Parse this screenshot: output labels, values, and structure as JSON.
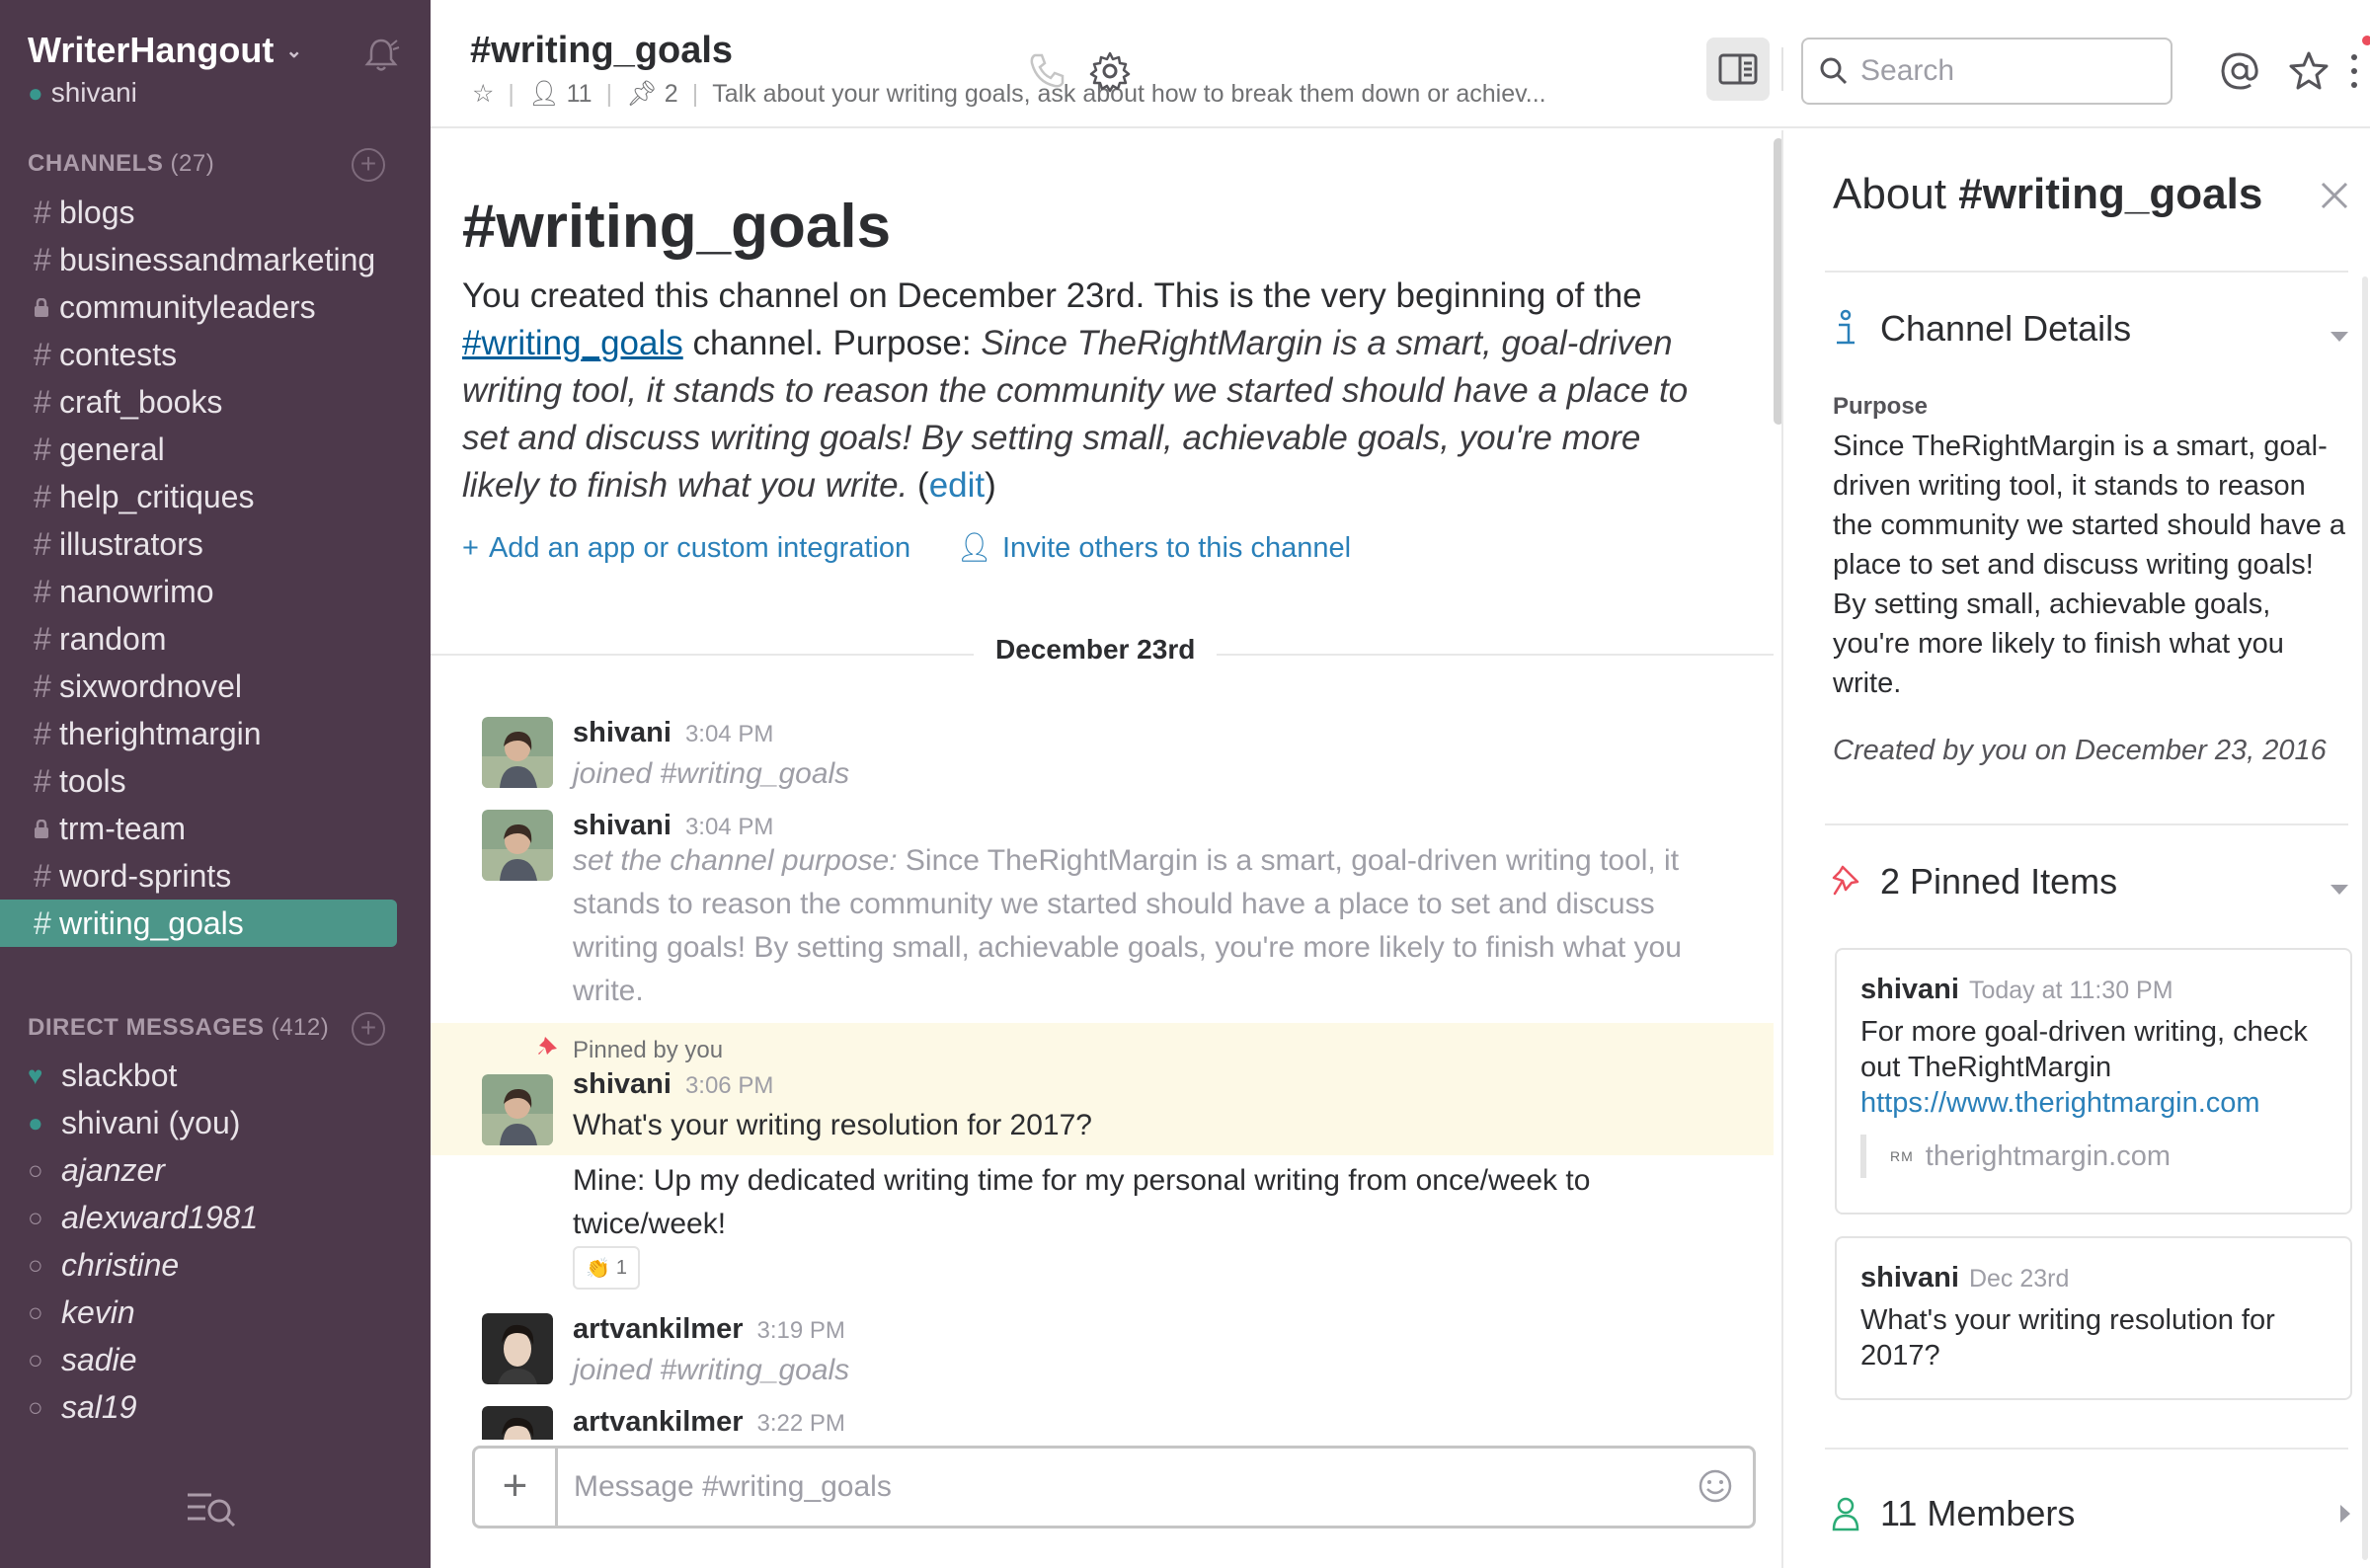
{
  "team": {
    "name": "WriterHangout",
    "user": "shivani"
  },
  "sidebar": {
    "channels_header": "CHANNELS",
    "channels_count": "(27)",
    "channels": [
      {
        "name": "blogs",
        "icon": "hash",
        "active": false
      },
      {
        "name": "businessandmarketing",
        "icon": "hash",
        "active": false
      },
      {
        "name": "communityleaders",
        "icon": "lock",
        "active": false
      },
      {
        "name": "contests",
        "icon": "hash",
        "active": false
      },
      {
        "name": "craft_books",
        "icon": "hash",
        "active": false
      },
      {
        "name": "general",
        "icon": "hash",
        "active": false
      },
      {
        "name": "help_critiques",
        "icon": "hash",
        "active": false
      },
      {
        "name": "illustrators",
        "icon": "hash",
        "active": false
      },
      {
        "name": "nanowrimo",
        "icon": "hash",
        "active": false
      },
      {
        "name": "random",
        "icon": "hash",
        "active": false
      },
      {
        "name": "sixwordnovel",
        "icon": "hash",
        "active": false
      },
      {
        "name": "therightmargin",
        "icon": "hash",
        "active": false
      },
      {
        "name": "tools",
        "icon": "hash",
        "active": false
      },
      {
        "name": "trm-team",
        "icon": "lock",
        "active": false
      },
      {
        "name": "word-sprints",
        "icon": "hash",
        "active": false
      },
      {
        "name": "writing_goals",
        "icon": "hash",
        "active": true
      }
    ],
    "dm_header": "DIRECT MESSAGES",
    "dm_count": "(412)",
    "dms": [
      {
        "name": "slackbot",
        "icon": "heart",
        "italic": false
      },
      {
        "name": "shivani (you)",
        "icon": "online",
        "italic": false
      },
      {
        "name": "ajanzer",
        "icon": "offline",
        "italic": true
      },
      {
        "name": "alexward1981",
        "icon": "offline",
        "italic": true
      },
      {
        "name": "christine",
        "icon": "offline",
        "italic": true
      },
      {
        "name": "kevin",
        "icon": "offline",
        "italic": true
      },
      {
        "name": "sadie",
        "icon": "offline",
        "italic": true
      },
      {
        "name": "sal19",
        "icon": "offline",
        "italic": true
      }
    ]
  },
  "header": {
    "title": "#writing_goals",
    "members": "11",
    "pins": "2",
    "topic": "Talk about your writing goals, ask about how to break them down or achiev...",
    "search_placeholder": "Search"
  },
  "intro": {
    "title": "#writing_goals",
    "created_text": "You created this channel on December 23rd. This is the very beginning of the",
    "channel_link": "#writing_goals",
    "purpose_prefix": "channel. Purpose:",
    "purpose_text": "Since TheRightMargin is a smart, goal-driven writing tool, it stands to reason the community we started should have a place to set and discuss writing goals! By setting small, achievable goals, you're more likely to finish what you write.",
    "edit_label": "edit",
    "add_app_label": "Add an app or custom integration",
    "invite_label": "Invite others to this channel"
  },
  "day_divider": "December 23rd",
  "messages": [
    {
      "author": "shivani",
      "time": "3:04 PM",
      "text": "joined #writing_goals"
    },
    {
      "author": "shivani",
      "time": "3:04 PM",
      "prefix": "set the channel purpose:",
      "text": "Since TheRightMargin is a smart, goal-driven writing tool, it stands to reason the community we started should have a place to set and discuss writing goals! By setting small, achievable goals, you're more likely to finish what you write."
    },
    {
      "pinned_label": "Pinned by you",
      "author": "shivani",
      "time": "3:06 PM",
      "text": "What's your writing resolution for 2017?",
      "reaction_emoji": "👏",
      "reaction_count": "1"
    },
    {
      "text": "Mine: Up my dedicated writing time for my personal writing from once/week to twice/week!"
    },
    {
      "author": "artvankilmer",
      "time": "3:19 PM",
      "text": "joined #writing_goals"
    },
    {
      "author": "artvankilmer",
      "time": "3:22 PM"
    }
  ],
  "composer": {
    "placeholder": "Message #writing_goals"
  },
  "panel": {
    "title_prefix": "About",
    "title_channel": "#writing_goals",
    "details_label": "Channel Details",
    "purpose_label": "Purpose",
    "purpose_text": "Since TheRightMargin is a smart, goal-driven writing tool, it stands to reason the community we started should have a place to set and discuss writing goals! By setting small, achievable goals, you're more likely to finish what you write.",
    "created": "Created by you on December 23, 2016",
    "pinned_label": "2 Pinned Items",
    "pins": [
      {
        "author": "shivani",
        "time": "Today at 11:30 PM",
        "text": "For more goal-driven writing, check out TheRightMargin",
        "link": "https://www.therightmargin.com",
        "unfurl_favicon": "RM",
        "unfurl": "therightmargin.com"
      },
      {
        "author": "shivani",
        "time": "Dec 23rd",
        "text": "What's your writing resolution for 2017?"
      }
    ],
    "members_label": "11 Members"
  },
  "colors": {
    "sidebar_bg": "#4d394b",
    "active_channel": "#4c9689",
    "link": "#2a80b9",
    "pinned_bg": "#fdf9e6",
    "presence": "#38978d",
    "pin_red": "#eb4d5c"
  }
}
